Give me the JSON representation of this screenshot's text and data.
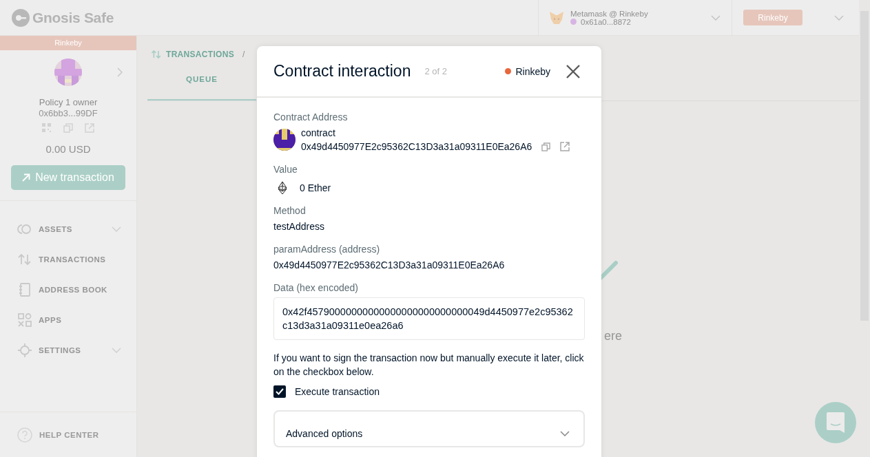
{
  "header": {
    "logo": "Gnosis Safe",
    "wallet": {
      "name": "Metamask @ Rinkeby",
      "address": "0x61a0...8872"
    },
    "network_button": "Rinkeby"
  },
  "sidebar": {
    "network_banner": "Rinkeby",
    "safe_name": "Policy 1 owner",
    "safe_address": "0x6bb3...99DF",
    "balance": "0.00 USD",
    "new_transaction_button": "New transaction",
    "nav": [
      {
        "label": "ASSETS",
        "expandable": true
      },
      {
        "label": "TRANSACTIONS",
        "expandable": false
      },
      {
        "label": "ADDRESS BOOK",
        "expandable": false
      },
      {
        "label": "APPS",
        "expandable": false
      },
      {
        "label": "SETTINGS",
        "expandable": true
      }
    ],
    "help": "HELP CENTER"
  },
  "main": {
    "breadcrumb": "TRANSACTIONS",
    "breadcrumb_separator": "/",
    "tabs": [
      {
        "label": "QUEUE",
        "selected": true
      }
    ],
    "empty_state_text": "ere"
  },
  "modal": {
    "title": "Contract interaction",
    "step": "2 of 2",
    "network": "Rinkeby",
    "fields": [
      {
        "kind": "address",
        "label": "Contract Address",
        "name": "contract",
        "value": "0x49d4450977E2c95362C13D3a31a09311E0Ea26A6"
      },
      {
        "kind": "amount",
        "label": "Value",
        "value": "0 Ether"
      },
      {
        "kind": "text",
        "label": "Method",
        "value": "testAddress"
      },
      {
        "kind": "text",
        "label": "paramAddress (address)",
        "value": "0x49d4450977E2c95362C13D3a31a09311E0Ea26A6"
      },
      {
        "kind": "hex",
        "label": "Data (hex encoded)",
        "value": "0x42f45790000000000000000000000000049d4450977e2c95362c13d3a31a09311e0ea26a6"
      }
    ],
    "note": "If you want to sign the transaction now but manually execute it later, click on the checkbox below.",
    "checkbox": {
      "label": "Execute transaction",
      "checked": true
    },
    "advanced": {
      "label": "Advanced options",
      "expanded": false
    }
  }
}
